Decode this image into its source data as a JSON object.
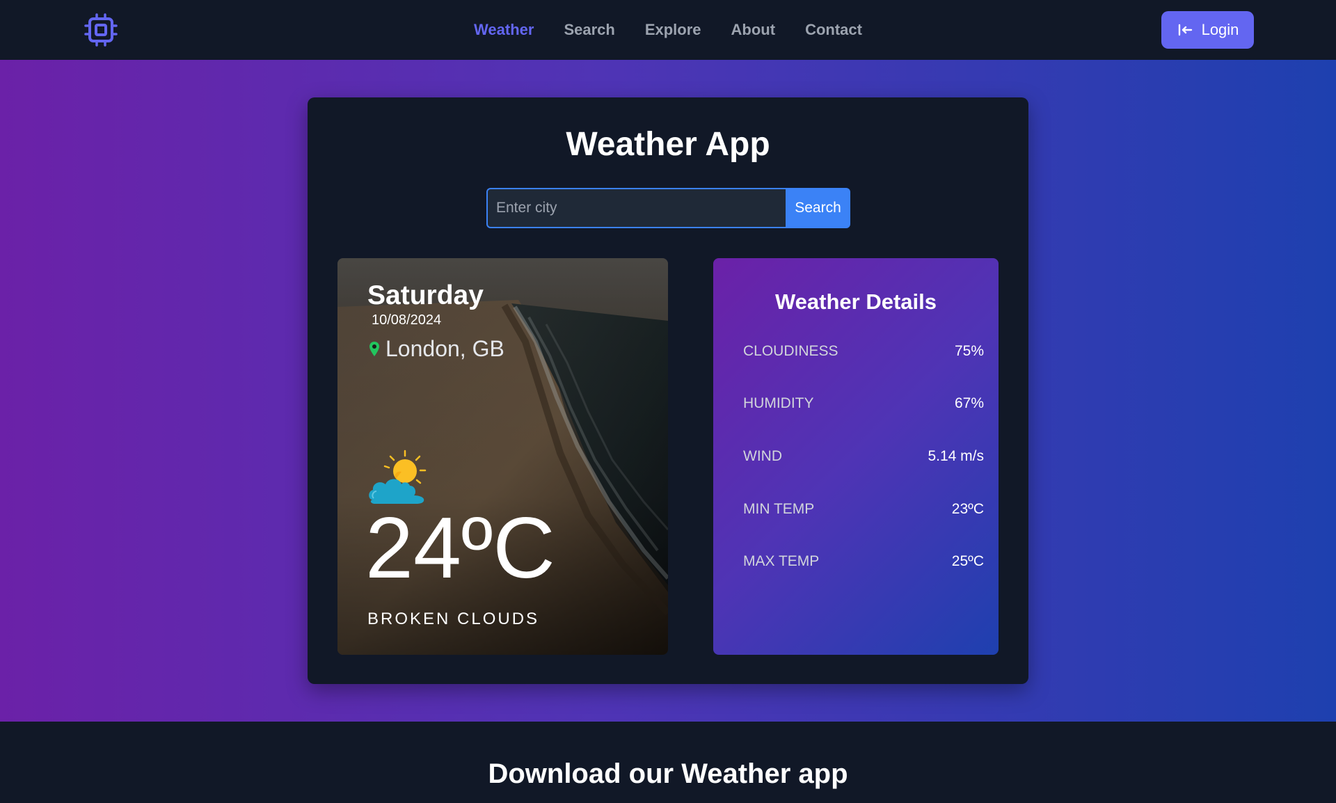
{
  "nav": {
    "links": [
      "Weather",
      "Search",
      "Explore",
      "About",
      "Contact"
    ],
    "active": "Weather",
    "login_label": "Login",
    "accent_color": "#6366f1"
  },
  "app": {
    "title": "Weather App",
    "search": {
      "placeholder": "Enter city",
      "value": "",
      "button_label": "Search"
    }
  },
  "current": {
    "day": "Saturday",
    "date": "10/08/2024",
    "location": "London, GB",
    "temperature": "24ºC",
    "description": "BROKEN CLOUDS",
    "icon": "sun-behind-cloud-icon"
  },
  "details": {
    "title": "Weather Details",
    "rows": [
      {
        "label": "CLOUDINESS",
        "value": "75%"
      },
      {
        "label": "HUMIDITY",
        "value": "67%"
      },
      {
        "label": "WIND",
        "value": "5.14 m/s"
      },
      {
        "label": "MIN TEMP",
        "value": "23ºC"
      },
      {
        "label": "MAX TEMP",
        "value": "25ºC"
      }
    ]
  },
  "footer": {
    "download_title": "Download our Weather app"
  }
}
